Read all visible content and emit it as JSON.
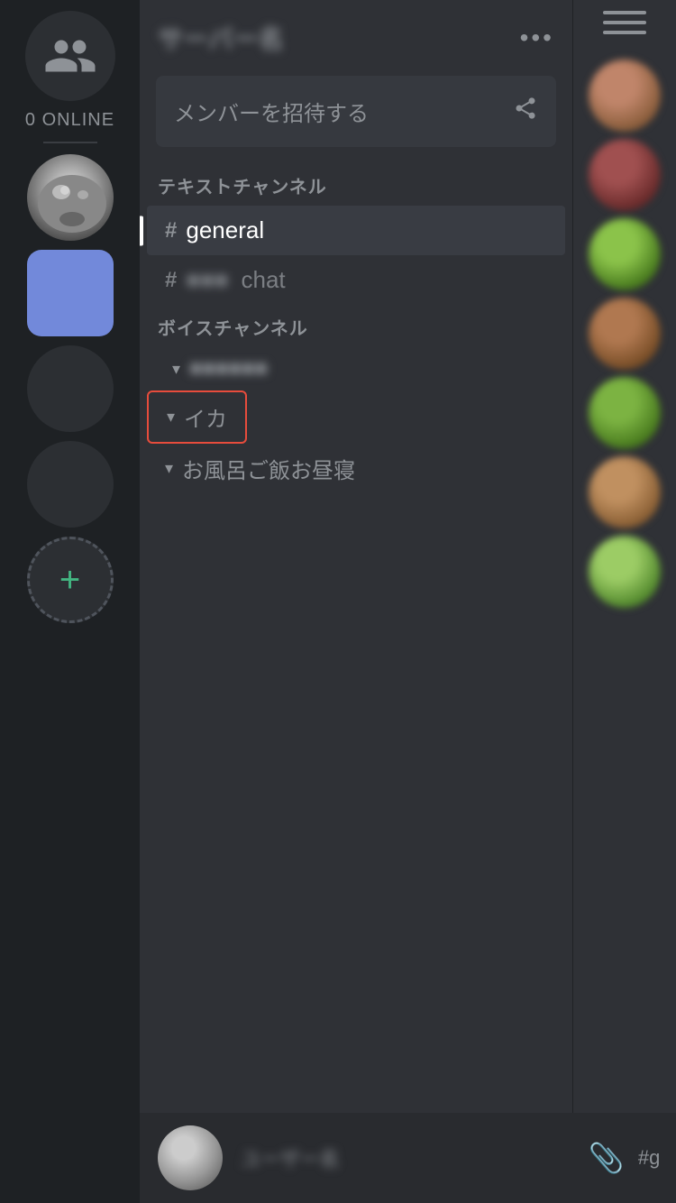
{
  "serverSidebar": {
    "onlineCount": "0 ONLINE",
    "addServerLabel": "+"
  },
  "header": {
    "serverName": "サーバー名",
    "dotsLabel": "•••"
  },
  "invite": {
    "placeholder": "メンバーを招待する",
    "iconLabel": "↑"
  },
  "sections": {
    "textChannels": "テキストチャンネル",
    "voiceChannels": "ボイスチャンネル"
  },
  "channels": {
    "general": "general",
    "chat": "chat",
    "chatBlurred": "■■■■",
    "voiceBlurred": "■■■■■■■",
    "ika": "イカ",
    "ofuro": "お風呂ご飯お昼寝"
  },
  "bottomBar": {
    "username": "ユーザー名",
    "mentionIcon": "@",
    "settingsIcon": "⚙",
    "clipIcon": "📎",
    "channelTag": "#g"
  },
  "members": {
    "menuLabel": "≡"
  }
}
